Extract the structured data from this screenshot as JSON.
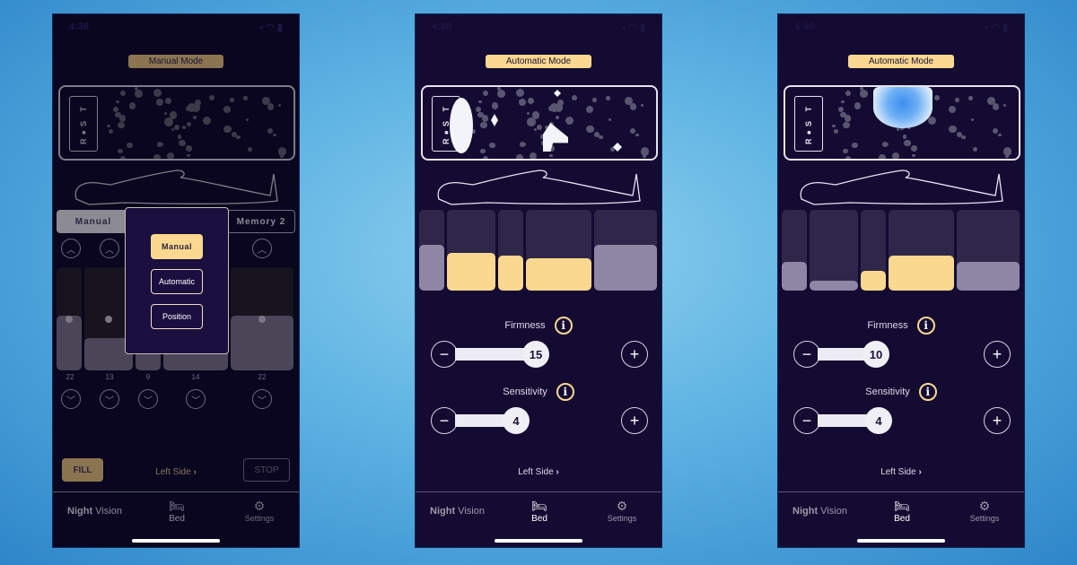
{
  "screens": [
    {
      "status_time": "4:38",
      "mode_label": "Manual Mode",
      "rest_logo": "R●S T",
      "segments": {
        "manual": "Manual",
        "memory2": "Memory 2"
      },
      "mode_popup": {
        "options": [
          "Manual",
          "Automatic",
          "Position"
        ],
        "selected": "Manual"
      },
      "zone_values": [
        "22",
        "13",
        "9",
        "14",
        "22"
      ],
      "zone_levels": [
        0.53,
        0.31,
        0.2,
        0.33,
        0.53
      ],
      "fill_label": "FILL",
      "stop_label": "STOP",
      "side_link": "Left Side",
      "side_chevron": "›",
      "tabbar": {
        "brand_bold": "Night",
        "brand_light": "Vision",
        "bed": "Bed",
        "settings": "Settings"
      }
    },
    {
      "status_time": "4:38",
      "mode_label": "Automatic Mode",
      "rest_logo": "R●S T",
      "zones": [
        {
          "level": 0.57,
          "active": false
        },
        {
          "level": 0.47,
          "active": true
        },
        {
          "level": 0.43,
          "active": true
        },
        {
          "level": 0.4,
          "active": true
        },
        {
          "level": 0.57,
          "active": false
        }
      ],
      "firmness": {
        "label": "Firmness",
        "value": "15"
      },
      "sensitivity": {
        "label": "Sensitivity",
        "value": "4"
      },
      "side_link": "Left Side",
      "side_chevron": "›",
      "tabbar": {
        "brand_bold": "Night",
        "brand_light": "Vision",
        "bed": "Bed",
        "settings": "Settings"
      }
    },
    {
      "status_time": "4:40",
      "mode_label": "Automatic Mode",
      "rest_logo": "R●S T",
      "zones": [
        {
          "level": 0.36,
          "active": false
        },
        {
          "level": 0.12,
          "active": false
        },
        {
          "level": 0.25,
          "active": true
        },
        {
          "level": 0.43,
          "active": true
        },
        {
          "level": 0.36,
          "active": false
        }
      ],
      "firmness": {
        "label": "Firmness",
        "value": "10"
      },
      "sensitivity": {
        "label": "Sensitivity",
        "value": "4"
      },
      "side_link": "Left Side",
      "side_chevron": "›",
      "tabbar": {
        "brand_bold": "Night",
        "brand_light": "Vision",
        "bed": "Bed",
        "settings": "Settings"
      }
    }
  ],
  "icons": {
    "info": "i",
    "minus": "−",
    "plus": "+",
    "up": "︿",
    "down": "﹀",
    "bed": "🛏",
    "gear": "⚙"
  },
  "colors": {
    "accent_gold": "#fbd88f",
    "background_navy": "#140b33",
    "zone_gray": "#8d87a5",
    "page_blue": "#5cb2e2"
  }
}
